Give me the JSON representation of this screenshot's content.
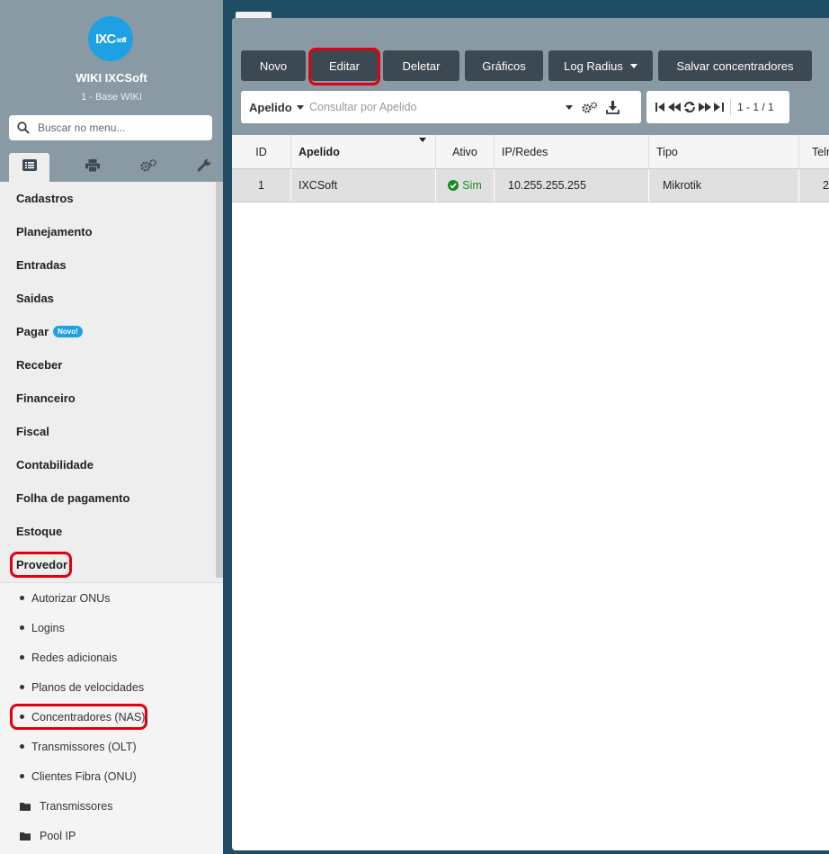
{
  "brand": {
    "logo_text": "IXC",
    "logo_suffix": "soft",
    "name": "WIKI IXCSoft",
    "sub": "1 - Base WIKI"
  },
  "sidebar": {
    "search_placeholder": "Buscar no menu...",
    "tabs": [
      {
        "icon": "list-icon",
        "active": true
      },
      {
        "icon": "print-icon",
        "active": false
      },
      {
        "icon": "gears-icon",
        "active": false
      },
      {
        "icon": "wrench-icon",
        "active": false
      }
    ],
    "items": [
      {
        "label": "Cadastros"
      },
      {
        "label": "Planejamento"
      },
      {
        "label": "Entradas"
      },
      {
        "label": "Saidas"
      },
      {
        "label": "Pagar",
        "badge": "Novo!"
      },
      {
        "label": "Receber"
      },
      {
        "label": "Financeiro"
      },
      {
        "label": "Fiscal"
      },
      {
        "label": "Contabilidade"
      },
      {
        "label": "Folha de pagamento"
      },
      {
        "label": "Estoque"
      },
      {
        "label": "Provedor"
      }
    ],
    "subitems": [
      {
        "label": "Autorizar ONUs",
        "type": "dot"
      },
      {
        "label": "Logins",
        "type": "dot"
      },
      {
        "label": "Redes adicionais",
        "type": "dot"
      },
      {
        "label": "Planos de velocidades",
        "type": "dot"
      },
      {
        "label": "Concentradores (NAS)",
        "type": "dot"
      },
      {
        "label": "Transmissores (OLT)",
        "type": "dot"
      },
      {
        "label": "Clientes Fibra (ONU)",
        "type": "dot"
      },
      {
        "label": "Transmissores",
        "type": "folder"
      },
      {
        "label": "Pool IP",
        "type": "folder"
      }
    ]
  },
  "toolbar": {
    "novo": "Novo",
    "editar": "Editar",
    "deletar": "Deletar",
    "graficos": "Gráficos",
    "log_radius": "Log Radius",
    "salvar": "Salvar concentradores"
  },
  "filter": {
    "field": "Apelido",
    "placeholder": "Consultar por Apelido"
  },
  "pager": {
    "info": "1 - 1 / 1"
  },
  "grid": {
    "columns": [
      "ID",
      "Apelido",
      "Ativo",
      "IP/Redes",
      "Tipo",
      "Teln"
    ],
    "rows": [
      {
        "id": "1",
        "apelido": "IXCSoft",
        "ativo": "Sim",
        "ip": "10.255.255.255",
        "tipo": "Mikrotik",
        "teln": "2"
      }
    ]
  },
  "colors": {
    "accent": "#1da1e4",
    "highlight": "#e10010",
    "button": "#3c4852",
    "panel": "#8a9aa5"
  }
}
